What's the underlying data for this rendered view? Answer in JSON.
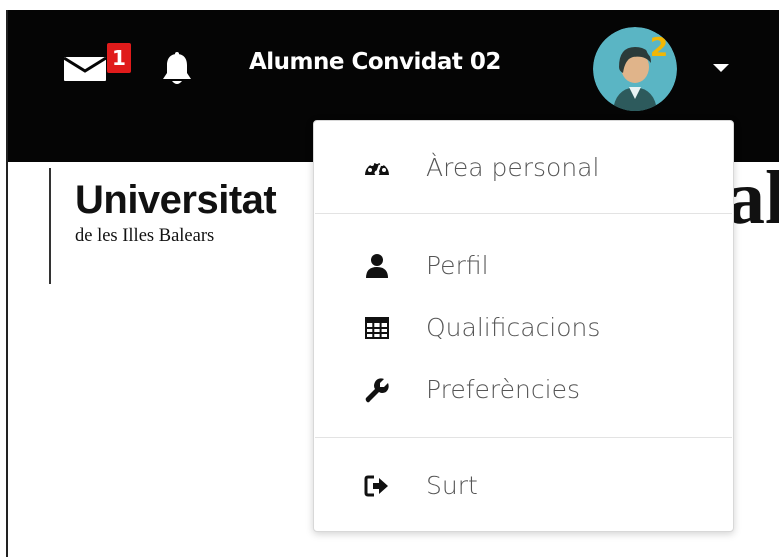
{
  "navbar": {
    "messages_badge": "1",
    "user_name": "Alumne Convidat 02",
    "avatar_badge_digit": "2"
  },
  "logo": {
    "title": "Universitat",
    "subtitle": "de les Illes Balears",
    "background_partial_text": "al"
  },
  "user_menu": {
    "items": [
      {
        "label": "Àrea personal",
        "icon": "dashboard-icon"
      },
      {
        "label": "Perfil",
        "icon": "user-icon"
      },
      {
        "label": "Qualificacions",
        "icon": "table-icon"
      },
      {
        "label": "Preferències",
        "icon": "wrench-icon"
      },
      {
        "label": "Surt",
        "icon": "sign-out-icon"
      }
    ]
  },
  "colors": {
    "navbar_bg": "#050505",
    "badge_red": "#e01b1b",
    "avatar_bg": "#5ab5c4",
    "avatar_badge": "#f2b705",
    "menu_text": "#555555"
  }
}
